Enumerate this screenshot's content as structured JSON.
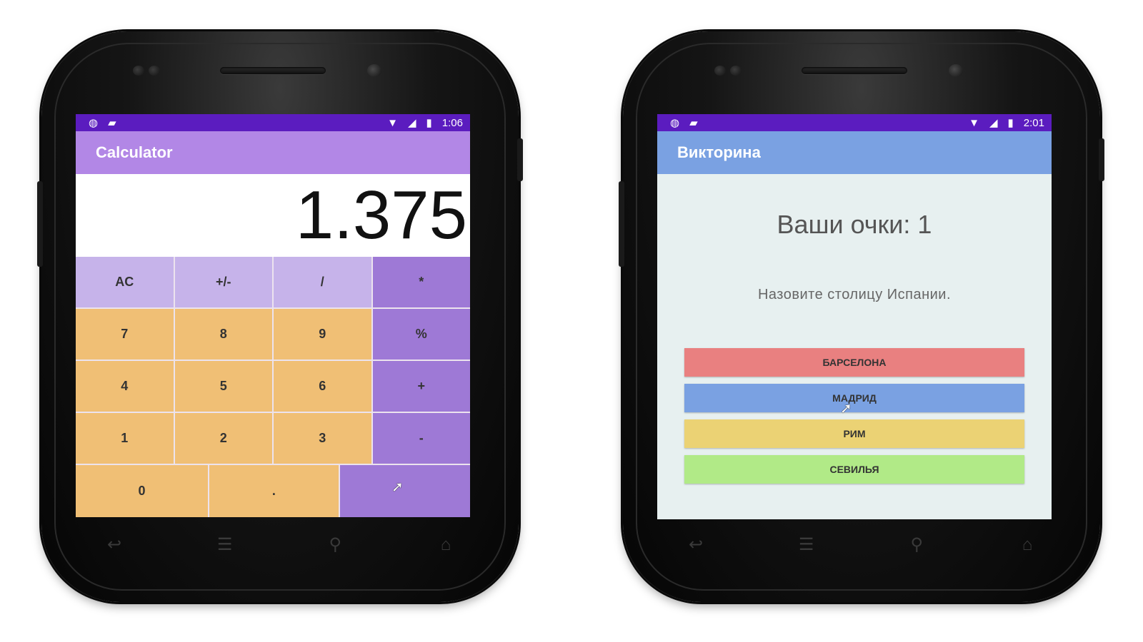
{
  "calculator": {
    "status_time": "1:06",
    "title": "Calculator",
    "display": "1.375",
    "keys": {
      "ac": "AC",
      "sign": "+/-",
      "divide": "/",
      "multiply": "*",
      "seven": "7",
      "eight": "8",
      "nine": "9",
      "percent": "%",
      "four": "4",
      "five": "5",
      "six": "6",
      "plus": "+",
      "one": "1",
      "two": "2",
      "three": "3",
      "minus": "-",
      "zero": "0",
      "dot": ".",
      "equals": ""
    },
    "colors": {
      "statusbar": "#5b1cbf",
      "appbar": "#b287e6",
      "function_key": "#c6b3ea",
      "operator_key": "#9e79d6",
      "number_key": "#f0bf75"
    }
  },
  "quiz": {
    "status_time": "2:01",
    "title": "Викторина",
    "score": "Ваши очки: 1",
    "question": "Назовите столицу Испании.",
    "answers": [
      "БАРСЕЛОНА",
      "МАДРИД",
      "РИМ",
      "СЕВИЛЬЯ"
    ],
    "colors": {
      "appbar": "#7aa1e2",
      "background": "#e7f0f0",
      "answer_1": "#e98080",
      "answer_2": "#7aa1e2",
      "answer_3": "#ebd274",
      "answer_4": "#b1ea87"
    }
  },
  "icons": {
    "status_left": [
      "notification-icon",
      "sd-card-icon"
    ],
    "status_right": [
      "wifi-icon",
      "signal-icon",
      "battery-icon"
    ],
    "nav": [
      "back-icon",
      "menu-icon",
      "search-icon",
      "home-icon"
    ]
  }
}
